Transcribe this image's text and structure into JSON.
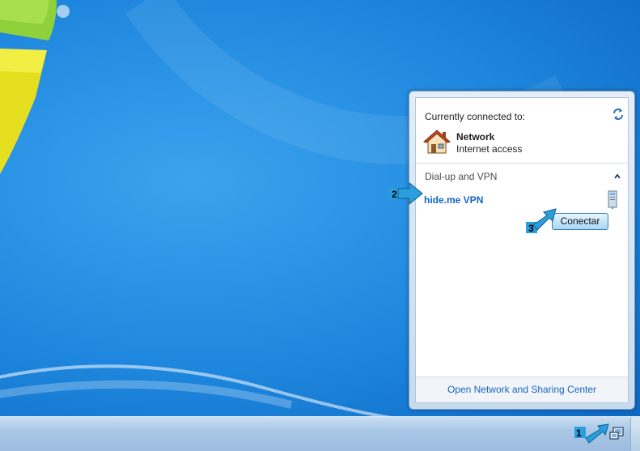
{
  "flyout": {
    "currently_connected_title": "Currently connected to:",
    "network_name": "Network",
    "network_status": "Internet access",
    "vpn_section_title": "Dial-up and VPN",
    "vpn_connection_name": "hide.me VPN",
    "connect_button_label": "Conectar",
    "footer_link": "Open Network and Sharing Center"
  },
  "callouts": {
    "step1": "1",
    "step2": "2",
    "step3": "3"
  },
  "colors": {
    "desktop_blue": "#1f88de",
    "link_blue": "#1563c4",
    "callout_arrow": "#2b9fde"
  },
  "icons": {
    "refresh": "refresh-arrows-icon",
    "network": "house-icon",
    "collapse": "chevron-up-icon",
    "vpn": "vpn-computer-icon",
    "tray": "network-tray-icon"
  }
}
